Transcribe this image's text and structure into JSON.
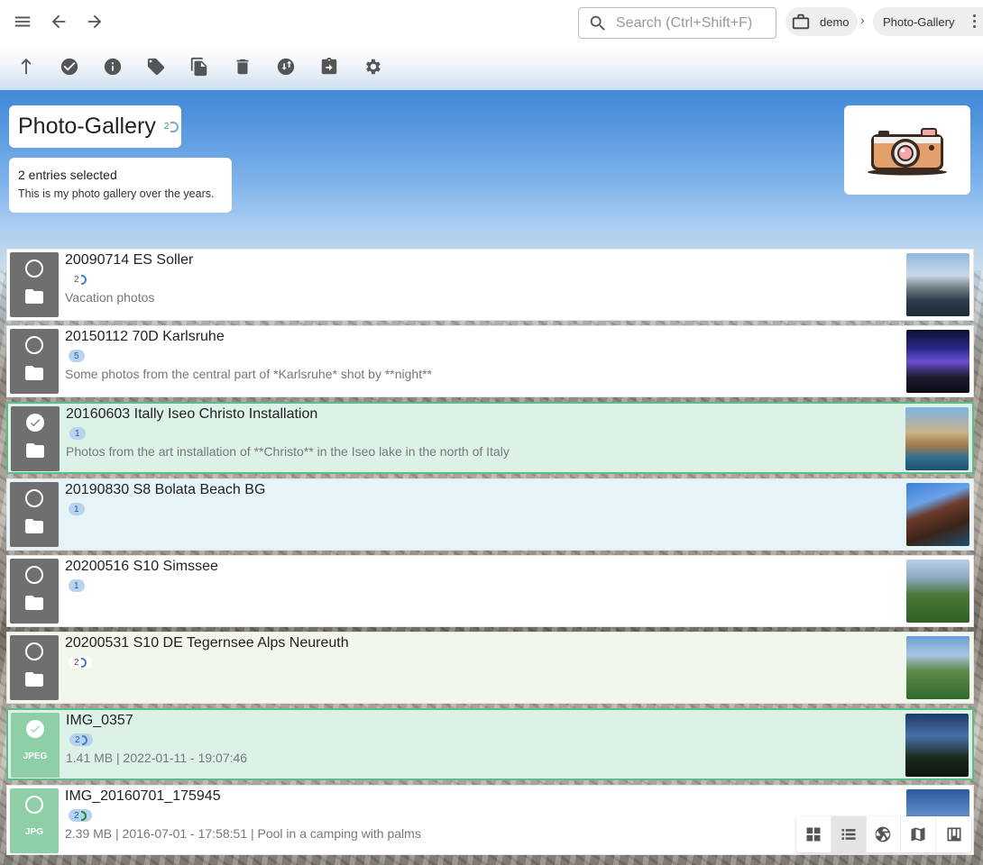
{
  "topbar": {
    "search_placeholder": "Search (Ctrl+Shift+F)",
    "breadcrumb_root": "demo",
    "breadcrumb_separator": "›",
    "breadcrumb_current": "Photo-Gallery"
  },
  "toolbar": {
    "icons": [
      "parent-folder-icon",
      "select-all-icon",
      "info-icon",
      "tag-icon",
      "copy-icon",
      "delete-icon",
      "sync-icon",
      "export-icon",
      "settings-icon"
    ]
  },
  "header": {
    "title": "Photo-Gallery",
    "title_badge_count": "2",
    "selection_text": "2 entries selected",
    "description": "This is my photo gallery over the years."
  },
  "items": [
    {
      "name": "20090714 ES Soller",
      "count": "2",
      "subtitle": "Vacation photos",
      "kind": "folder",
      "selected": false
    },
    {
      "name": "20150112 70D Karlsruhe",
      "count": "5",
      "subtitle": "Some photos from the central part of *Karlsruhe* shot by **night**",
      "kind": "folder",
      "selected": false
    },
    {
      "name": "20160603 Itally Iseo Christo Installation",
      "count": "1",
      "subtitle": "Photos from the art installation of **Christo** in the Iseo lake in the north of Italy",
      "kind": "folder",
      "selected": true
    },
    {
      "name": "20190830 S8 Bolata Beach BG",
      "count": "1",
      "subtitle": "",
      "kind": "folder",
      "selected": false
    },
    {
      "name": "20200516 S10 Simssee",
      "count": "1",
      "subtitle": "",
      "kind": "folder",
      "selected": false
    },
    {
      "name": "20200531 S10 DE Tegernsee Alps Neureuth",
      "count": "2",
      "subtitle": "",
      "kind": "folder",
      "selected": false
    },
    {
      "name": "IMG_0357",
      "count": "2",
      "subtitle": "1.41 MB | 2022-01-11 - 19:07:46",
      "kind": "file",
      "ext": "JPEG",
      "selected": true
    },
    {
      "name": "IMG_20160701_175945",
      "count": "2",
      "subtitle": "2.39 MB | 2016-07-01 - 17:58:51 | Pool in a camping with palms",
      "kind": "file",
      "ext": "JPG",
      "selected": false
    }
  ],
  "colors": {
    "selected_row": "#dcf2e6",
    "selected_border": "#5dbb8c",
    "folder_tile": "#6f6f6f",
    "file_tile": "#8fcfa8"
  },
  "viewswitch": {
    "icons": [
      "grid-view-icon",
      "list-view-icon",
      "aperture-view-icon",
      "map-view-icon",
      "kanban-view-icon"
    ],
    "active": "list-view-icon"
  }
}
